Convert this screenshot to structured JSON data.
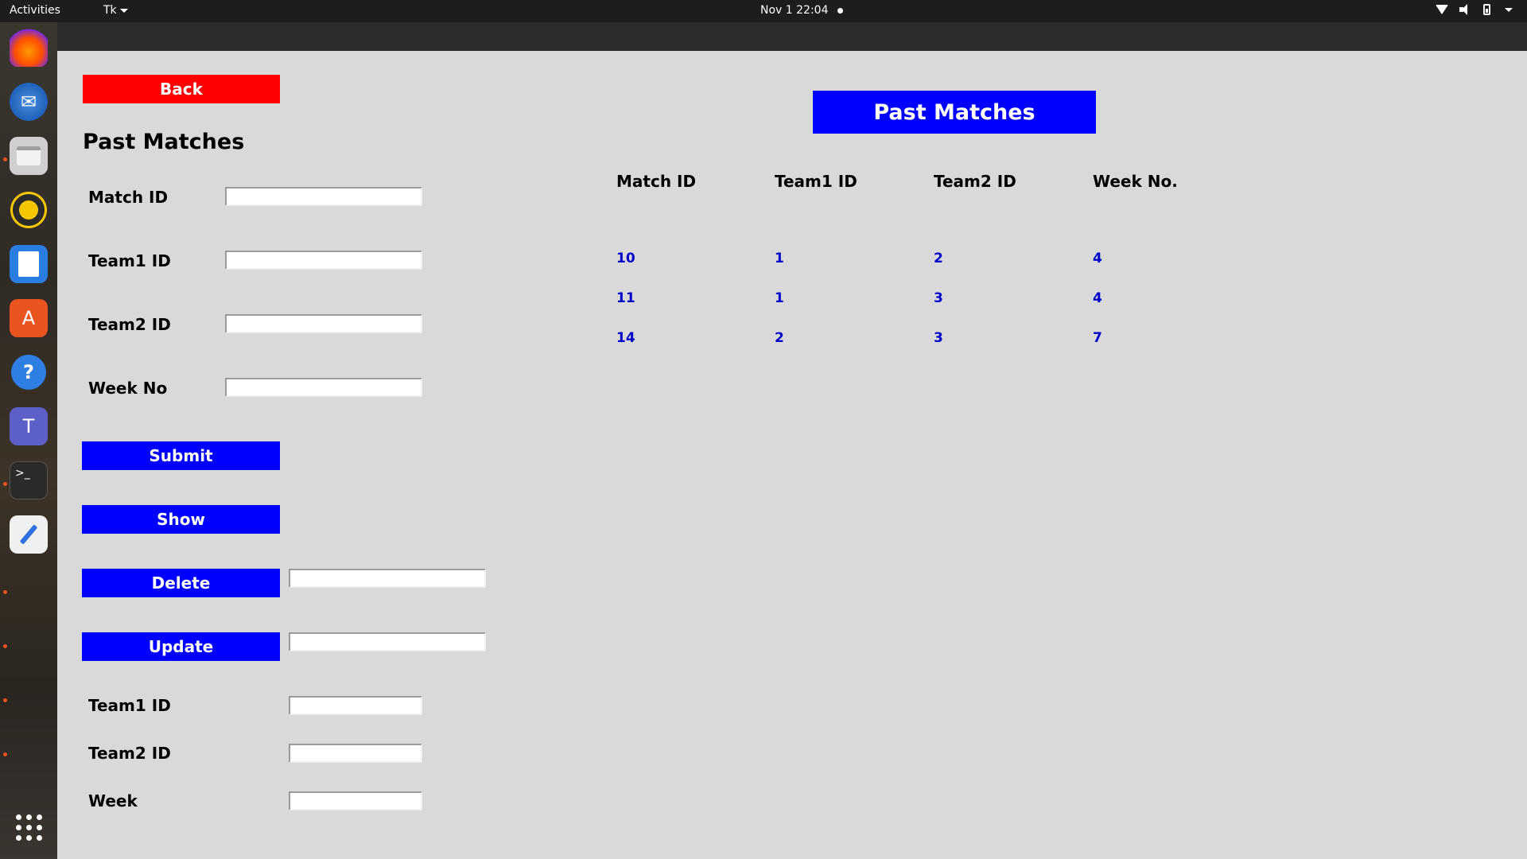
{
  "topbar": {
    "activities": "Activities",
    "app_menu": "Tk",
    "clock": "Nov 1  22:04"
  },
  "dock": {
    "icons": [
      "firefox-icon",
      "thunderbird-icon",
      "files-icon",
      "rhythmbox-icon",
      "libreoffice-writer-icon",
      "app-center-icon",
      "help-icon",
      "teams-icon",
      "terminal-icon",
      "text-editor-icon",
      "show-apps-icon"
    ]
  },
  "form": {
    "back_label": "Back",
    "title": "Past Matches",
    "match_id_label": "Match ID",
    "team1_id_label": "Team1 ID",
    "team2_id_label": "Team2 ID",
    "week_no_label": "Week No",
    "submit_label": "Submit",
    "show_label": "Show",
    "delete_label": "Delete",
    "update_label": "Update",
    "update_team1_label": "Team1 ID",
    "update_team2_label": "Team2 ID",
    "update_week_label": "Week"
  },
  "table": {
    "banner": "Past Matches",
    "headers": [
      "Match ID",
      "Team1 ID",
      "Team2 ID",
      "Week No."
    ],
    "rows": [
      [
        "10",
        "1",
        "2",
        "4"
      ],
      [
        "11",
        "1",
        "3",
        "4"
      ],
      [
        "14",
        "2",
        "3",
        "7"
      ]
    ]
  },
  "colors": {
    "button_blue": "#0000ff",
    "back_red": "#ff0000",
    "cell_text": "#0000cc",
    "background": "#d9d9d9"
  }
}
